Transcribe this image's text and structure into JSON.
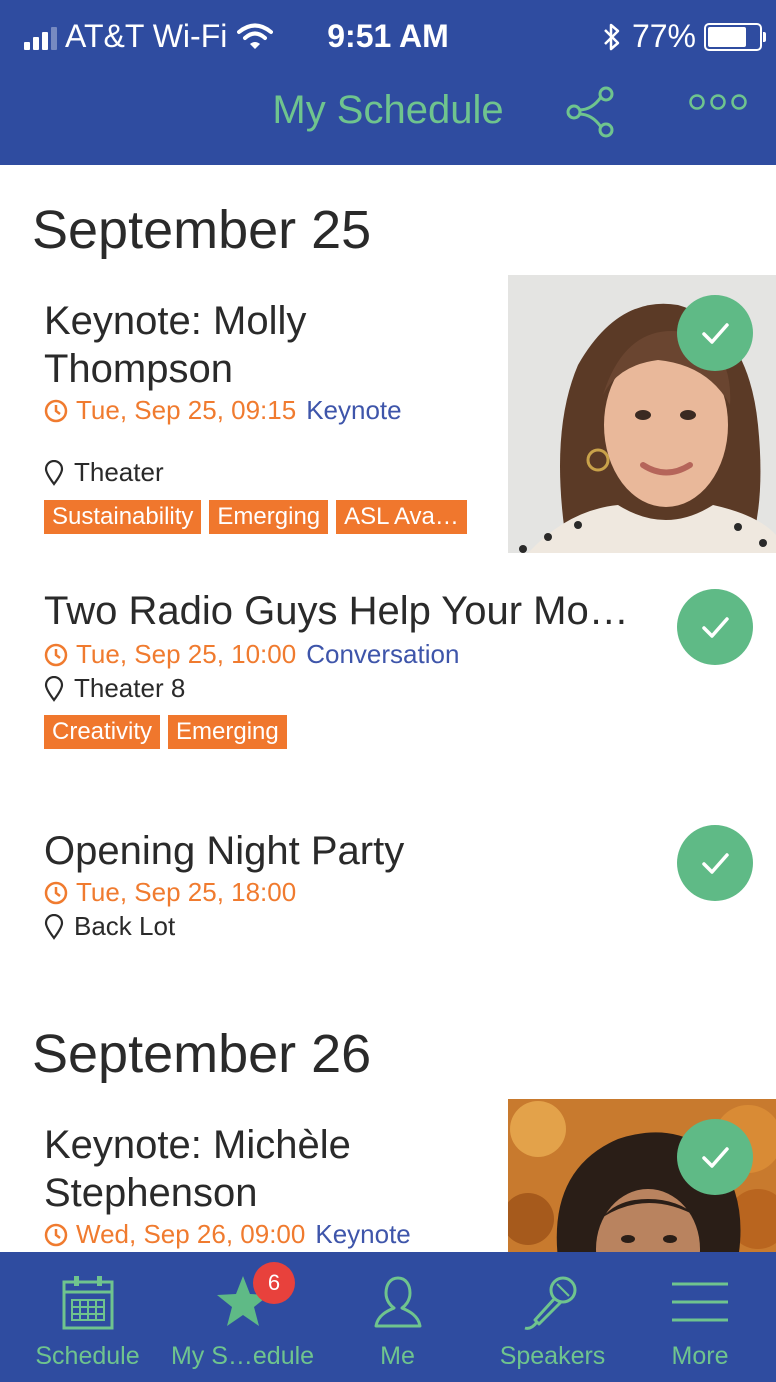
{
  "status_bar": {
    "carrier": "AT&T Wi-Fi",
    "time": "9:51 AM",
    "battery": "77%",
    "battery_level": 0.77
  },
  "nav": {
    "title": "My Schedule",
    "share_icon": "share-icon",
    "more_icon": "more-icon"
  },
  "days": [
    {
      "heading": "September 25",
      "sessions": [
        {
          "title_line1": "Keynote: Molly",
          "title_line2": "Thompson",
          "time": "Tue, Sep 25, 09:15",
          "track": "Keynote",
          "location": "Theater",
          "tags": [
            "Sustainability",
            "Emerging",
            "ASL Ava…"
          ],
          "saved": true
        },
        {
          "title_line1": "Two Radio Guys Help Your Mo…",
          "time": "Tue, Sep 25, 10:00",
          "track": "Conversation",
          "location": "Theater 8",
          "tags": [
            "Creativity",
            "Emerging"
          ],
          "saved": true
        },
        {
          "title_line1": "Opening Night Party",
          "time": "Tue, Sep 25, 18:00",
          "location": "Back Lot",
          "saved": true
        }
      ]
    },
    {
      "heading": "September 26",
      "sessions": [
        {
          "title_line1": "Keynote: Michèle",
          "title_line2": "Stephenson",
          "time": "Wed, Sep 26, 09:00",
          "track": "Keynote",
          "saved": true
        }
      ]
    }
  ],
  "tabbar": {
    "items": [
      {
        "label": "Schedule",
        "icon": "calendar-icon"
      },
      {
        "label": "My S…edule",
        "icon": "star-icon",
        "badge": "6"
      },
      {
        "label": "Me",
        "icon": "person-icon"
      },
      {
        "label": "Speakers",
        "icon": "microphone-icon"
      },
      {
        "label": "More",
        "icon": "menu-icon"
      }
    ]
  },
  "colors": {
    "bar_blue": "#2f4ca0",
    "accent_green": "#6fc48e",
    "check_green": "#5fba86",
    "time_orange": "#f07b2f",
    "tag_orange": "#f0772d",
    "track_blue": "#3e55aa",
    "badge_red": "#e8413c"
  }
}
